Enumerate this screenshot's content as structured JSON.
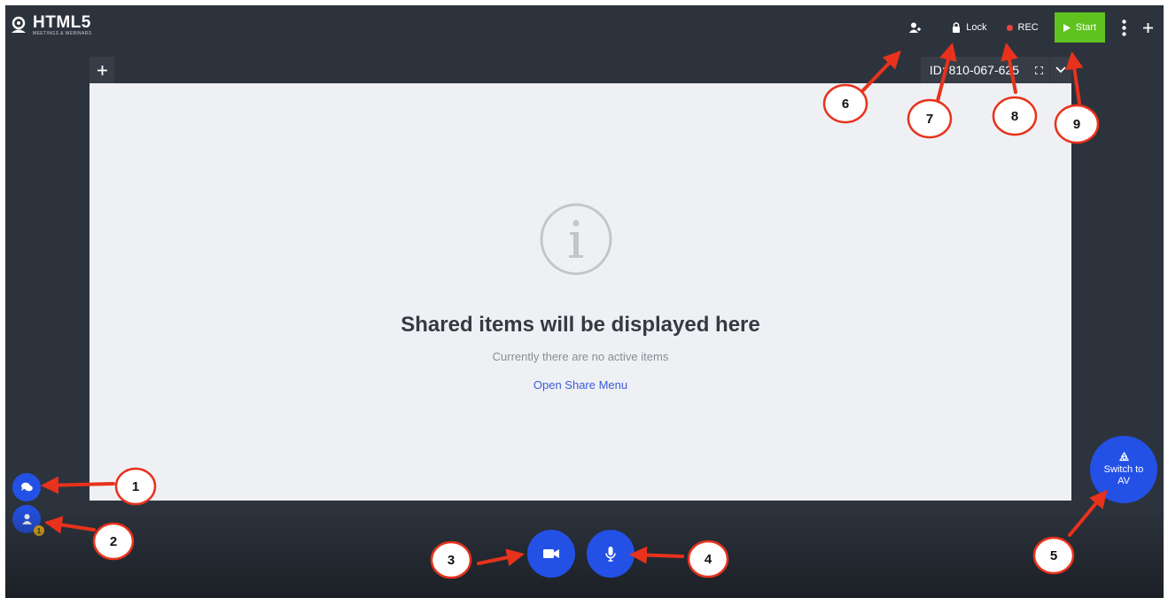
{
  "logo": {
    "title": "HTML5",
    "subtitle": "MEETINGS & WEBINARS"
  },
  "topbar": {
    "invite_icon": "add-user-icon",
    "lock_label": "Lock",
    "rec_label": "REC",
    "rec_color": "#e8453c",
    "start_label": "Start",
    "start_color": "#5fc21f"
  },
  "stage": {
    "room_id": "ID: 810-067-625",
    "title": "Shared items will be displayed here",
    "subtitle": "Currently there are no active items",
    "link": "Open Share Menu"
  },
  "sidebar": {
    "participants_badge": "1"
  },
  "switch_av": {
    "label": "Switch to AV"
  },
  "annotations": {
    "color": "#e8321c",
    "markers": [
      "1",
      "2",
      "3",
      "4",
      "5",
      "6",
      "7",
      "8",
      "9"
    ]
  },
  "colors": {
    "background": "#2d333d",
    "accent": "#2351e6",
    "stage": "#eff0f4"
  }
}
